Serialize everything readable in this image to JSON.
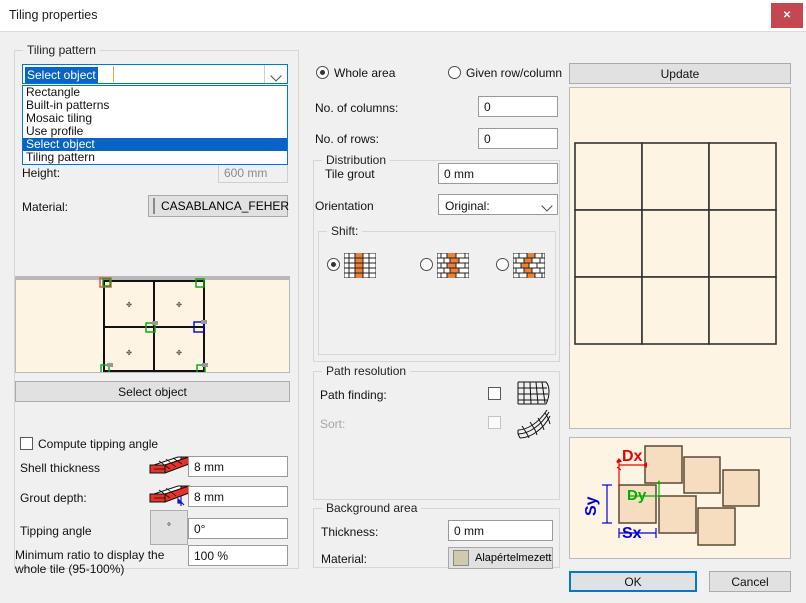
{
  "window": {
    "title": "Tiling properties",
    "close_label": "✕"
  },
  "left": {
    "group_label": "Tiling pattern",
    "combo": {
      "value": "Select object",
      "options": [
        "Rectangle",
        "Built-in patterns",
        "Mosaic tiling",
        "Use profile",
        "Select object",
        "Tiling pattern"
      ],
      "selected_index": 4
    },
    "height_label": "Height:",
    "height_value": "600 mm",
    "material_label": "Material:",
    "material_value": "CASABLANCA_FEHER",
    "select_object_button": "Select object",
    "compute_tipping_angle": "Compute tipping angle",
    "shell_thickness_label": "Shell thickness",
    "shell_thickness_value": "8 mm",
    "grout_depth_label": "Grout depth:",
    "grout_depth_value": "8 mm",
    "tipping_angle_label": "Tipping angle",
    "tipping_angle_value": "0°",
    "degree_icon": "°",
    "min_ratio_label": "Minimum ratio to display the whole tile (95-100%)",
    "min_ratio_value": "100 %"
  },
  "middle": {
    "whole_area": "Whole area",
    "given_row_column": "Given row/column",
    "columns_label": "No. of columns:",
    "columns_value": "0",
    "rows_label": "No. of rows:",
    "rows_value": "0",
    "distribution_label": "Distribution",
    "tile_grout_label": "Tile grout",
    "tile_grout_value": "0 mm",
    "orientation_label": "Orientation",
    "orientation_value": "Original:",
    "shift_label": "Shift:",
    "path_resolution_label": "Path resolution",
    "path_finding_label": "Path finding:",
    "sort_label": "Sort:",
    "background_area_label": "Background area",
    "thickness_label": "Thickness:",
    "thickness_value": "0 mm",
    "bg_material_label": "Material:",
    "bg_material_value": "Alapértelmezett"
  },
  "right": {
    "update_button": "Update",
    "dim_dx": "Dx",
    "dim_dy": "Dy",
    "dim_sx": "Sx",
    "dim_sy": "Sy"
  },
  "footer": {
    "ok": "OK",
    "cancel": "Cancel"
  },
  "colors": {
    "accent": "#0078d7",
    "close": "#c5474f",
    "tile_fill": "#fdf4e3",
    "tile_block": "#f7ddc0",
    "brick_orange": "#ef8033",
    "dx": "#ee0000",
    "dy": "#00b000",
    "sx": "#0000dd"
  }
}
